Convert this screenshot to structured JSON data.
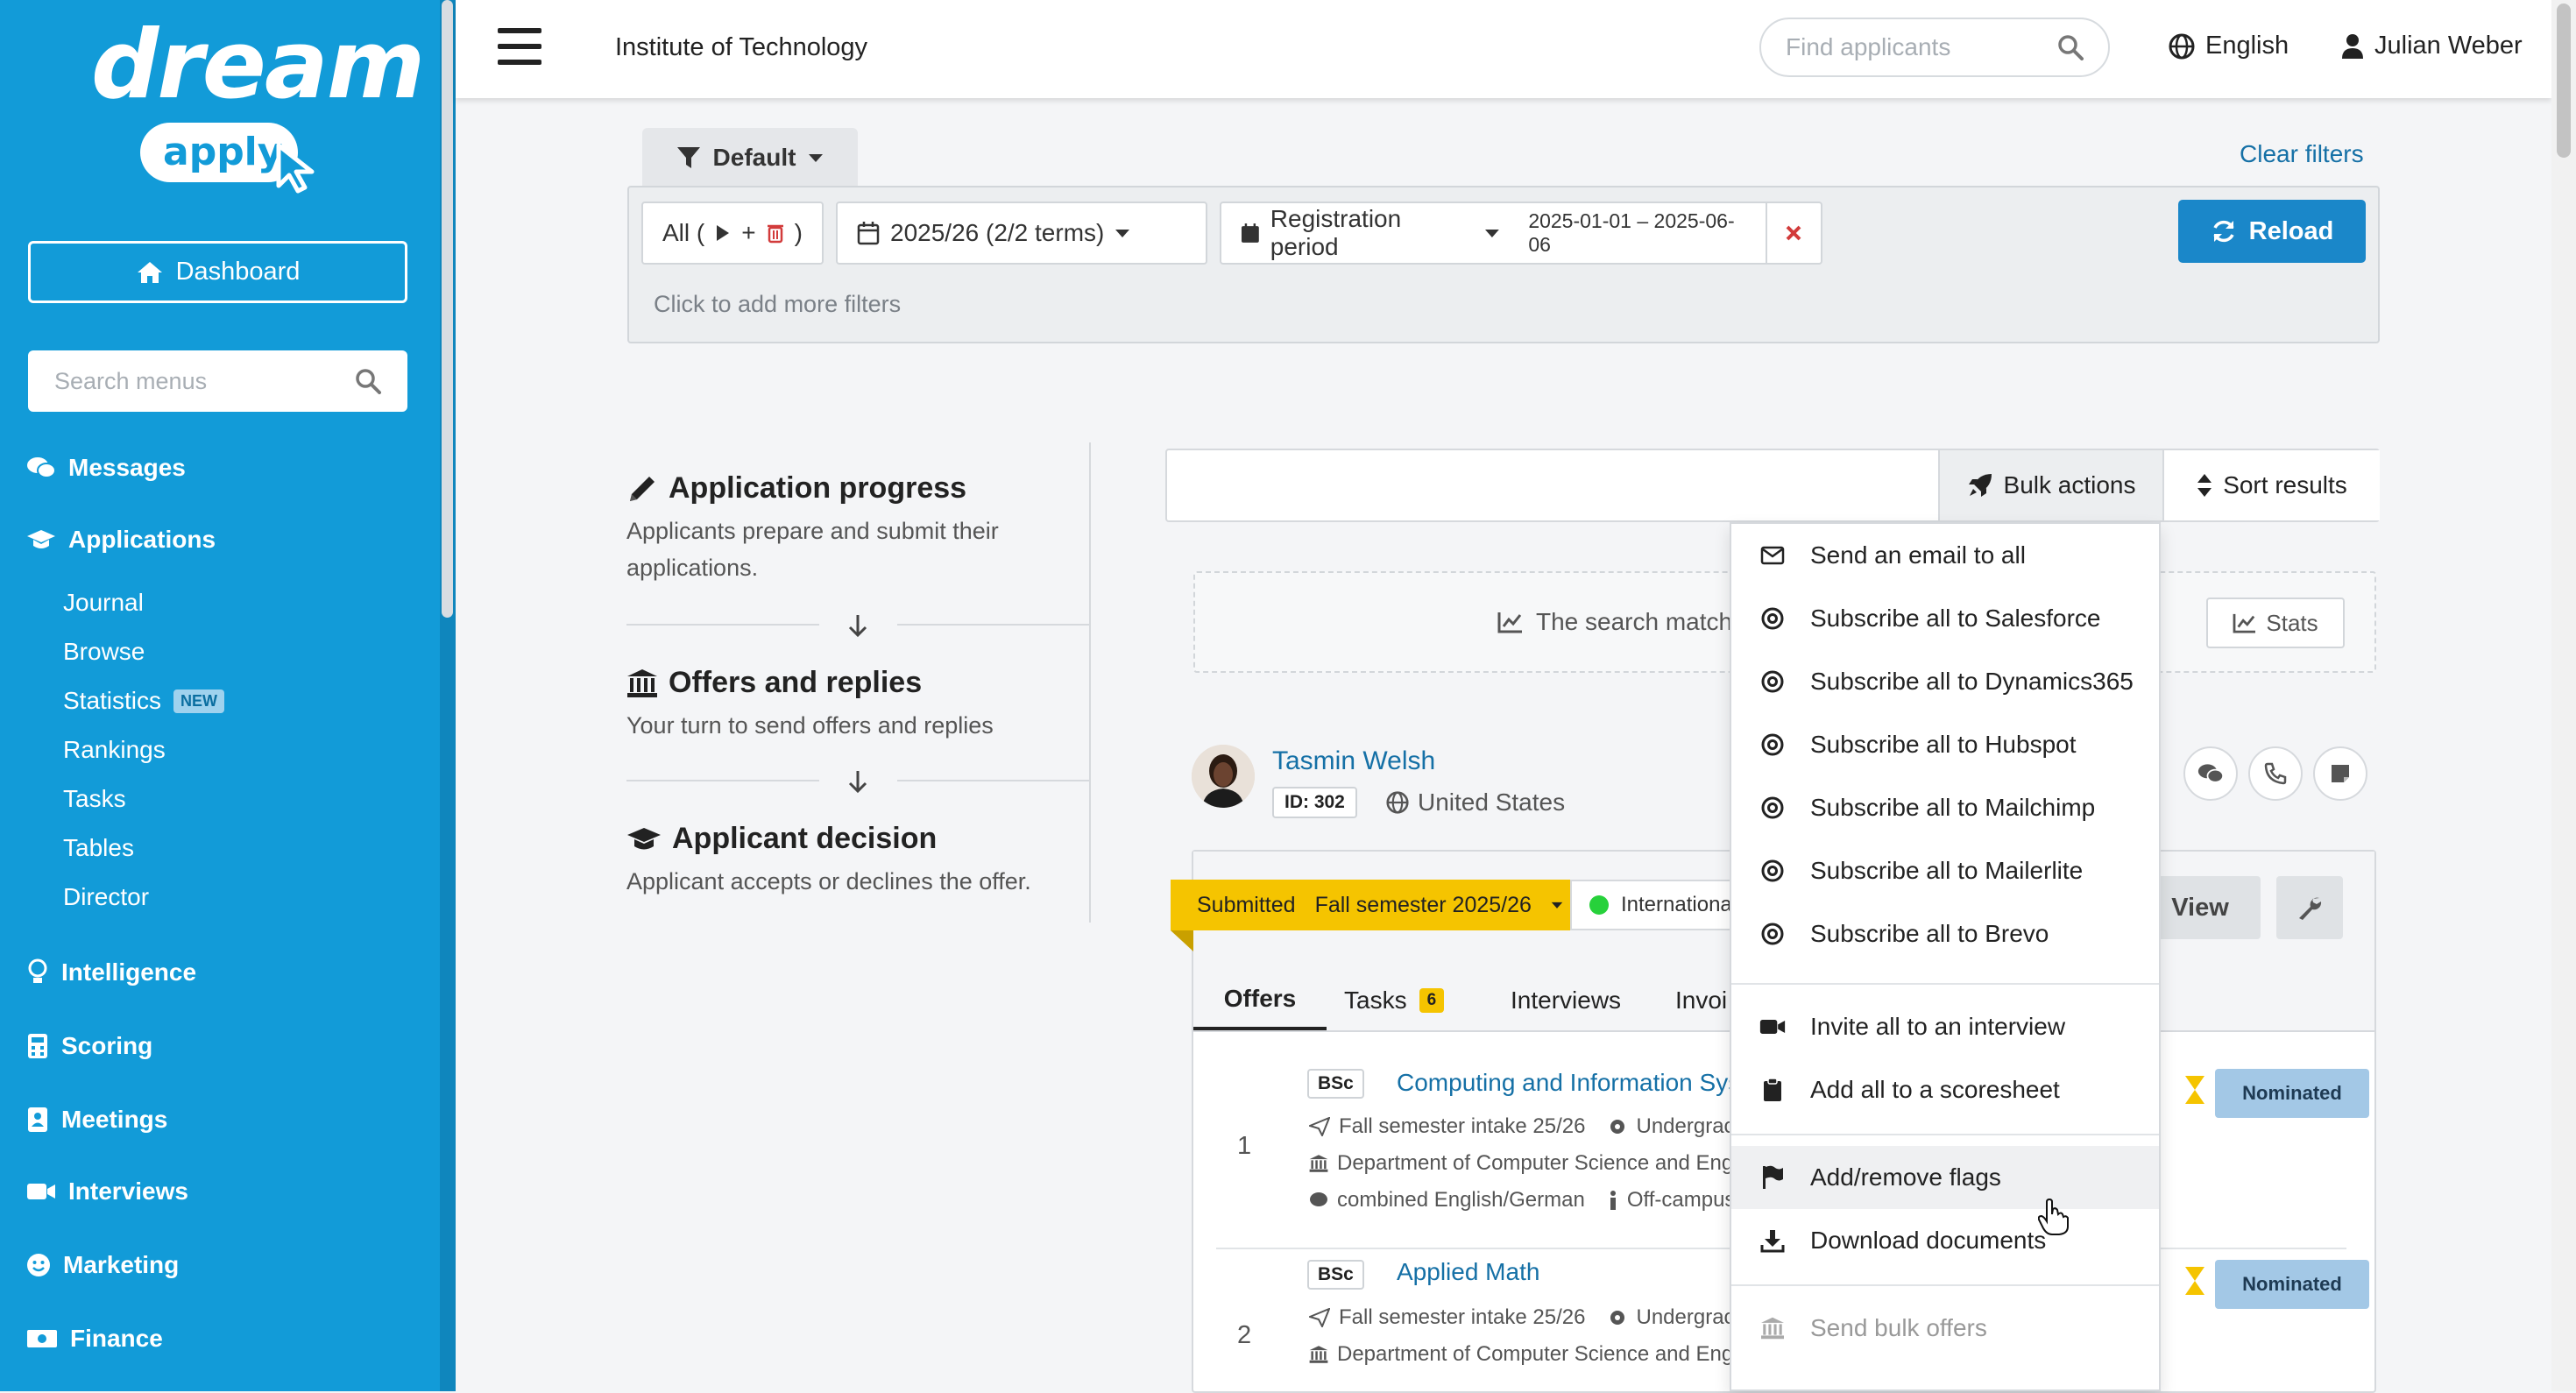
{
  "sidebar": {
    "logo_word": "dream",
    "logo_sub": "apply",
    "dashboard_label": "Dashboard",
    "search_placeholder": "Search menus",
    "messages": "Messages",
    "applications": "Applications",
    "applications_sub": [
      "Journal",
      "Browse",
      "Statistics",
      "Rankings",
      "Tasks",
      "Tables",
      "Director"
    ],
    "new_badge": "NEW",
    "intelligence": "Intelligence",
    "scoring": "Scoring",
    "meetings": "Meetings",
    "interviews": "Interviews",
    "marketing": "Marketing",
    "finance": "Finance"
  },
  "header": {
    "title": "Institute of Technology",
    "search_placeholder": "Find applicants",
    "language": "English",
    "user": "Julian Weber"
  },
  "filters": {
    "preset": "Default",
    "clear_label": "Clear filters",
    "all_chip_prefix": "All (",
    "all_chip_suffix": ")",
    "term_chip": "2025/26 (2/2 terms)",
    "period_label": "Registration period",
    "period_range": "2025-01-01 – 2025-06-06",
    "reload_label": "Reload",
    "add_more": "Click to add more filters"
  },
  "progress": {
    "stage1_title": "Application progress",
    "stage1_desc_line1": "Applicants prepare and submit their",
    "stage1_desc_line2": "applications.",
    "stage2_title": "Offers and replies",
    "stage2_desc": "Your turn to send offers and replies",
    "stage3_title": "Applicant decision",
    "stage3_desc": "Applicant accepts or declines the offer."
  },
  "results": {
    "bulk_label": "Bulk actions",
    "sort_label": "Sort results",
    "match_text": "The search matche",
    "stats_label": "Stats"
  },
  "applicant": {
    "name": "Tasmin Welsh",
    "id": "ID: 302",
    "country": "United States",
    "status": "Submitted",
    "intake": "Fall semester 2025/26",
    "chip": "Internationa",
    "view_label": "View",
    "tabs": [
      "Offers",
      "Tasks",
      "Interviews",
      "Invoi"
    ],
    "tasks_count": "6",
    "offers": [
      {
        "number": "1",
        "degree": "BSc",
        "program": "Computing and Information Syst",
        "intake": "Fall semester intake 25/26",
        "level": "Undergrac",
        "department": "Department of Computer Science and Eng",
        "language": "combined English/German",
        "mode": "Off-campus",
        "status": "Nominated"
      },
      {
        "number": "2",
        "degree": "BSc",
        "program": "Applied Math",
        "intake": "Fall semester intake 25/26",
        "level": "Undergrac",
        "department": "Department of Computer Science and Eng",
        "status": "Nominated"
      }
    ]
  },
  "bulk_menu": {
    "items": [
      "Send an email to all",
      "Subscribe all to Salesforce",
      "Subscribe all to Dynamics365",
      "Subscribe all to Hubspot",
      "Subscribe all to Mailchimp",
      "Subscribe all to Mailerlite",
      "Subscribe all to Brevo",
      "Invite all to an interview",
      "Add all to a scoresheet",
      "Add/remove flags",
      "Download documents",
      "Send bulk offers"
    ]
  },
  "colors": {
    "sidebar_bg": "#129bd8",
    "primary_button": "#1a87c9",
    "link": "#1570a6",
    "submitted_badge": "#f5c400",
    "nominated_badge": "#a3c8e6"
  }
}
